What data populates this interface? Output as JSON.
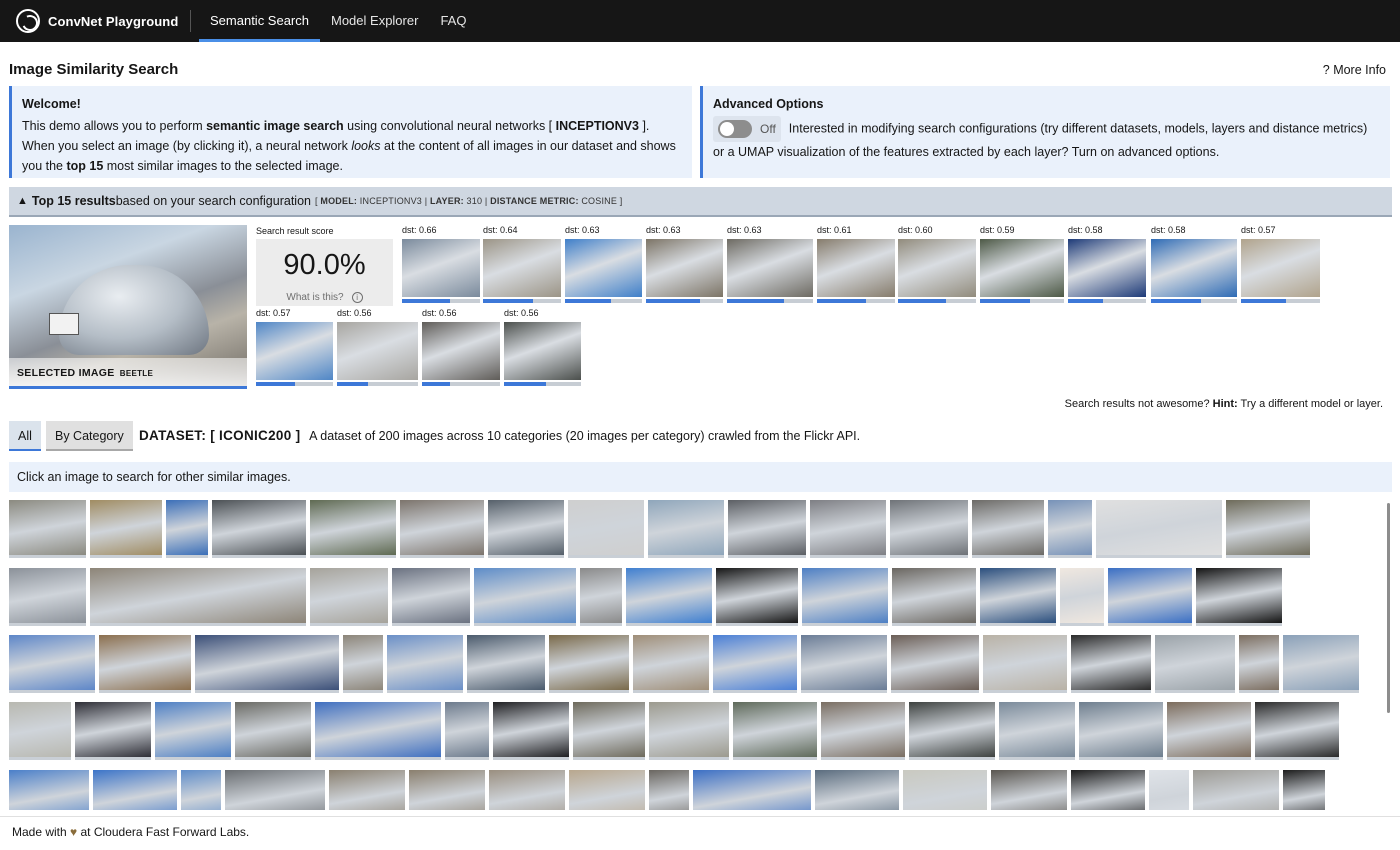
{
  "nav": {
    "brand": "ConvNet Playground",
    "items": [
      "Semantic Search",
      "Model Explorer",
      "FAQ"
    ],
    "active_index": 0
  },
  "page": {
    "title": "Image Similarity Search",
    "more_info": "? More Info"
  },
  "welcome": {
    "heading": "Welcome!",
    "p1_pre": "This demo allows you to perform ",
    "p1_bold": "semantic image search",
    "p1_mid": " using convolutional neural networks [ ",
    "p1_model": "INCEPTIONV3",
    "p1_post": " ].",
    "p2_pre": "When you select an image (by clicking it), a neural network ",
    "p2_em": "looks",
    "p2_mid": " at the content of all images in our dataset and shows you the ",
    "p2_bold": "top 15",
    "p2_post": " most similar images to the selected image."
  },
  "advanced": {
    "heading": "Advanced Options",
    "toggle_label": "Off",
    "toggle_on": false,
    "text": "Interested in modifying search configurations (try different datasets, models, layers and distance metrics) or a UMAP visualization of the features extracted by each layer? Turn on advanced options."
  },
  "results_bar": {
    "arrow": "▲",
    "bold": "Top 15 results",
    "rest": " based on your search configuration",
    "cfg_open": "[ ",
    "model_key": "MODEL:",
    "model_val": "INCEPTIONV3",
    "sep1": " | ",
    "layer_key": "LAYER:",
    "layer_val": "310",
    "sep2": " | ",
    "metric_key": "DISTANCE METRIC:",
    "metric_val": "COSINE",
    "cfg_close": " ]"
  },
  "selected": {
    "label": "SELECTED IMAGE",
    "category": "BEETLE"
  },
  "score": {
    "label": "Search result score",
    "value": "90.0%",
    "help": "What is this?"
  },
  "results": [
    {
      "dst": "dst: 0.66",
      "similarity": 0.62,
      "color": "#7a8a9c"
    },
    {
      "dst": "dst: 0.64",
      "similarity": 0.64,
      "color": "#9b9486"
    },
    {
      "dst": "dst: 0.63",
      "similarity": 0.6,
      "color": "#3f7fc9"
    },
    {
      "dst": "dst: 0.63",
      "similarity": 0.7,
      "color": "#7c7466"
    },
    {
      "dst": "dst: 0.63",
      "similarity": 0.66,
      "color": "#6d6a62"
    },
    {
      "dst": "dst: 0.61",
      "similarity": 0.63,
      "color": "#867c6c"
    },
    {
      "dst": "dst: 0.60",
      "similarity": 0.62,
      "color": "#918b7c"
    },
    {
      "dst": "dst: 0.59",
      "similarity": 0.6,
      "color": "#4d5946"
    },
    {
      "dst": "dst: 0.58",
      "similarity": 0.45,
      "color": "#1d3a78"
    },
    {
      "dst": "dst: 0.58",
      "similarity": 0.58,
      "color": "#2e6bb5"
    },
    {
      "dst": "dst: 0.57",
      "similarity": 0.57,
      "color": "#b0a38c"
    },
    {
      "dst": "dst: 0.57",
      "similarity": 0.5,
      "color": "#4f86c6"
    },
    {
      "dst": "dst: 0.56",
      "similarity": 0.38,
      "color": "#a7a5a0"
    },
    {
      "dst": "dst: 0.56",
      "similarity": 0.36,
      "color": "#5f5c58"
    },
    {
      "dst": "dst: 0.56",
      "similarity": 0.55,
      "color": "#4b4f4c"
    }
  ],
  "hint": {
    "pre": "Search results not awesome? ",
    "bold": "Hint:",
    "post": " Try a different model or layer."
  },
  "tabs": [
    "All",
    "By Category"
  ],
  "active_tab": 0,
  "dataset": {
    "name": "DATASET: [ ICONIC200 ]",
    "description": "A dataset of 200 images across 10 categories (20 images per category) crawled from the Flickr API."
  },
  "click_hint": "Click an image to search for other similar images.",
  "gallery_colors": [
    "#8b8a80",
    "#a08c62",
    "#3b6fb8",
    "#4b5054",
    "#5f6a52",
    "#7c746c",
    "#56606a",
    "#cfcfcf",
    "#8fa6bb",
    "#5c5f64",
    "#7e7f84",
    "#6f7378",
    "#6c6a66",
    "#7792b8",
    "#e0e0e0",
    "#6e6b5a",
    "#8b9199",
    "#8d8578",
    "#a6a39b",
    "#6a7180",
    "#5d8cc8",
    "#8a8a8a",
    "#3f7fd0",
    "#161616",
    "#4d7fc4",
    "#6a6660",
    "#2b4f7e",
    "#f0e8e0",
    "#3a6fc4",
    "#141414",
    "#5d86c8",
    "#8b6f4e",
    "#3b4f78",
    "#8c8579",
    "#6a8fc7",
    "#4a5a6c",
    "#7a6a4a",
    "#9f8e78",
    "#4a7fd6",
    "#6a7c96",
    "#6b5e56",
    "#b9b2a6",
    "#2a2a2a",
    "#9aa2a8",
    "#7c6e60",
    "#8aa0b8",
    "#b8b8b0",
    "#2e2e36",
    "#4d7fc4",
    "#6a6a64",
    "#3f6fc0",
    "#6c7a8c",
    "#1f1f22",
    "#6e6a5c",
    "#9c9a8e",
    "#5f6a5a",
    "#7a6e62",
    "#3e4240",
    "#7a8a9a",
    "#6e7e8e",
    "#7c6c5c",
    "#2a2a2a",
    "#4a7fc9",
    "#3b74c8",
    "#5f8dc9",
    "#6a6e72",
    "#8a8070",
    "#8a7f6e",
    "#9a8f80",
    "#b8a78e",
    "#6a6660",
    "#3b6fc4",
    "#5a6c7e",
    "#c9c9c0",
    "#5a5650",
    "#1c1c1c",
    "#dfe3e8",
    "#9c9a94",
    "#1c1c1c"
  ],
  "footer": {
    "pre": "Made with ",
    "heart": "♥",
    "mid": " at ",
    "link": "Cloudera Fast Forward Labs",
    "post": "."
  }
}
